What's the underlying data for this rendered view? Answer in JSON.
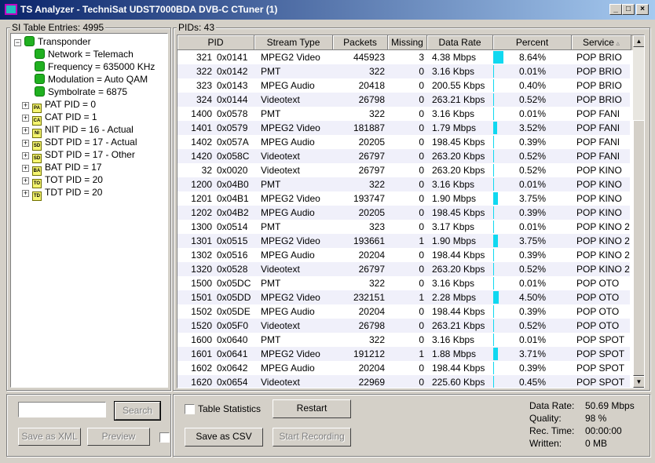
{
  "window": {
    "title": "TS Analyzer - TechniSat UDST7000BDA DVB-C CTuner (1)"
  },
  "left": {
    "group_label": "SI Table Entries: 4995",
    "tree": {
      "root": "Transponder",
      "children": [
        "Network = Telemach",
        "Frequency = 635000 KHz",
        "Modulation = Auto QAM",
        "Symbolrate = 6875"
      ],
      "tables": [
        {
          "label": "PAT PID = 0",
          "tag": "PA"
        },
        {
          "label": "CAT PID = 1",
          "tag": "CA"
        },
        {
          "label": "NIT PID = 16 - Actual",
          "tag": "NI"
        },
        {
          "label": "SDT PID = 17 - Actual",
          "tag": "SD"
        },
        {
          "label": "SDT PID = 17 - Other",
          "tag": "SD"
        },
        {
          "label": "BAT PID = 17",
          "tag": "BA"
        },
        {
          "label": "TOT PID = 20",
          "tag": "TO"
        },
        {
          "label": "TDT PID = 20",
          "tag": "TD"
        }
      ]
    },
    "search_value": "",
    "search_label": "Search",
    "save_xml_label": "Save as XML",
    "preview_label": "Preview"
  },
  "right": {
    "group_label": "PIDs: 43",
    "columns": [
      "PID",
      "Stream Type",
      "Packets",
      "Missing",
      "Data Rate",
      "Percent",
      "Service"
    ],
    "rows": [
      {
        "pid": "321",
        "hex": "0x0141",
        "type": "MPEG2 Video",
        "packets": "445923",
        "missing": "3",
        "rate": "4.38 Mbps",
        "percent": "8.64%",
        "pct": 8.64,
        "service": "POP BRIO"
      },
      {
        "pid": "322",
        "hex": "0x0142",
        "type": "PMT",
        "packets": "322",
        "missing": "0",
        "rate": "3.16 Kbps",
        "percent": "0.01%",
        "pct": 0.01,
        "service": "POP BRIO"
      },
      {
        "pid": "323",
        "hex": "0x0143",
        "type": "MPEG Audio",
        "packets": "20418",
        "missing": "0",
        "rate": "200.55 Kbps",
        "percent": "0.40%",
        "pct": 0.4,
        "service": "POP BRIO"
      },
      {
        "pid": "324",
        "hex": "0x0144",
        "type": "Videotext",
        "packets": "26798",
        "missing": "0",
        "rate": "263.21 Kbps",
        "percent": "0.52%",
        "pct": 0.52,
        "service": "POP BRIO"
      },
      {
        "pid": "1400",
        "hex": "0x0578",
        "type": "PMT",
        "packets": "322",
        "missing": "0",
        "rate": "3.16 Kbps",
        "percent": "0.01%",
        "pct": 0.01,
        "service": "POP FANI"
      },
      {
        "pid": "1401",
        "hex": "0x0579",
        "type": "MPEG2 Video",
        "packets": "181887",
        "missing": "0",
        "rate": "1.79 Mbps",
        "percent": "3.52%",
        "pct": 3.52,
        "service": "POP FANI"
      },
      {
        "pid": "1402",
        "hex": "0x057A",
        "type": "MPEG Audio",
        "packets": "20205",
        "missing": "0",
        "rate": "198.45 Kbps",
        "percent": "0.39%",
        "pct": 0.39,
        "service": "POP FANI"
      },
      {
        "pid": "1420",
        "hex": "0x058C",
        "type": "Videotext",
        "packets": "26797",
        "missing": "0",
        "rate": "263.20 Kbps",
        "percent": "0.52%",
        "pct": 0.52,
        "service": "POP FANI"
      },
      {
        "pid": "32",
        "hex": "0x0020",
        "type": "Videotext",
        "packets": "26797",
        "missing": "0",
        "rate": "263.20 Kbps",
        "percent": "0.52%",
        "pct": 0.52,
        "service": "POP KINO"
      },
      {
        "pid": "1200",
        "hex": "0x04B0",
        "type": "PMT",
        "packets": "322",
        "missing": "0",
        "rate": "3.16 Kbps",
        "percent": "0.01%",
        "pct": 0.01,
        "service": "POP KINO"
      },
      {
        "pid": "1201",
        "hex": "0x04B1",
        "type": "MPEG2 Video",
        "packets": "193747",
        "missing": "0",
        "rate": "1.90 Mbps",
        "percent": "3.75%",
        "pct": 3.75,
        "service": "POP KINO"
      },
      {
        "pid": "1202",
        "hex": "0x04B2",
        "type": "MPEG Audio",
        "packets": "20205",
        "missing": "0",
        "rate": "198.45 Kbps",
        "percent": "0.39%",
        "pct": 0.39,
        "service": "POP KINO"
      },
      {
        "pid": "1300",
        "hex": "0x0514",
        "type": "PMT",
        "packets": "323",
        "missing": "0",
        "rate": "3.17 Kbps",
        "percent": "0.01%",
        "pct": 0.01,
        "service": "POP KINO 2"
      },
      {
        "pid": "1301",
        "hex": "0x0515",
        "type": "MPEG2 Video",
        "packets": "193661",
        "missing": "1",
        "rate": "1.90 Mbps",
        "percent": "3.75%",
        "pct": 3.75,
        "service": "POP KINO 2"
      },
      {
        "pid": "1302",
        "hex": "0x0516",
        "type": "MPEG Audio",
        "packets": "20204",
        "missing": "0",
        "rate": "198.44 Kbps",
        "percent": "0.39%",
        "pct": 0.39,
        "service": "POP KINO 2"
      },
      {
        "pid": "1320",
        "hex": "0x0528",
        "type": "Videotext",
        "packets": "26797",
        "missing": "0",
        "rate": "263.20 Kbps",
        "percent": "0.52%",
        "pct": 0.52,
        "service": "POP KINO 2"
      },
      {
        "pid": "1500",
        "hex": "0x05DC",
        "type": "PMT",
        "packets": "322",
        "missing": "0",
        "rate": "3.16 Kbps",
        "percent": "0.01%",
        "pct": 0.01,
        "service": "POP OTO"
      },
      {
        "pid": "1501",
        "hex": "0x05DD",
        "type": "MPEG2 Video",
        "packets": "232151",
        "missing": "1",
        "rate": "2.28 Mbps",
        "percent": "4.50%",
        "pct": 4.5,
        "service": "POP OTO"
      },
      {
        "pid": "1502",
        "hex": "0x05DE",
        "type": "MPEG Audio",
        "packets": "20204",
        "missing": "0",
        "rate": "198.44 Kbps",
        "percent": "0.39%",
        "pct": 0.39,
        "service": "POP OTO"
      },
      {
        "pid": "1520",
        "hex": "0x05F0",
        "type": "Videotext",
        "packets": "26798",
        "missing": "0",
        "rate": "263.21 Kbps",
        "percent": "0.52%",
        "pct": 0.52,
        "service": "POP OTO"
      },
      {
        "pid": "1600",
        "hex": "0x0640",
        "type": "PMT",
        "packets": "322",
        "missing": "0",
        "rate": "3.16 Kbps",
        "percent": "0.01%",
        "pct": 0.01,
        "service": "POP SPOT"
      },
      {
        "pid": "1601",
        "hex": "0x0641",
        "type": "MPEG2 Video",
        "packets": "191212",
        "missing": "1",
        "rate": "1.88 Mbps",
        "percent": "3.71%",
        "pct": 3.71,
        "service": "POP SPOT"
      },
      {
        "pid": "1602",
        "hex": "0x0642",
        "type": "MPEG Audio",
        "packets": "20204",
        "missing": "0",
        "rate": "198.44 Kbps",
        "percent": "0.39%",
        "pct": 0.39,
        "service": "POP SPOT"
      },
      {
        "pid": "1620",
        "hex": "0x0654",
        "type": "Videotext",
        "packets": "22969",
        "missing": "0",
        "rate": "225.60 Kbps",
        "percent": "0.45%",
        "pct": 0.45,
        "service": "POP SPOT"
      }
    ],
    "table_statistics_label": "Table Statistics",
    "restart_label": "Restart",
    "save_csv_label": "Save as CSV",
    "start_recording_label": "Start Recording",
    "stats": [
      {
        "label": "Data Rate:",
        "value": "50.69 Mbps"
      },
      {
        "label": "Quality:",
        "value": "98 %"
      },
      {
        "label": "Rec. Time:",
        "value": "00:00:00"
      },
      {
        "label": "Written:",
        "value": "0 MB"
      }
    ]
  },
  "colors": {
    "accent": "#0a246a",
    "bar": "#10d8f0",
    "node": "#20b020"
  }
}
